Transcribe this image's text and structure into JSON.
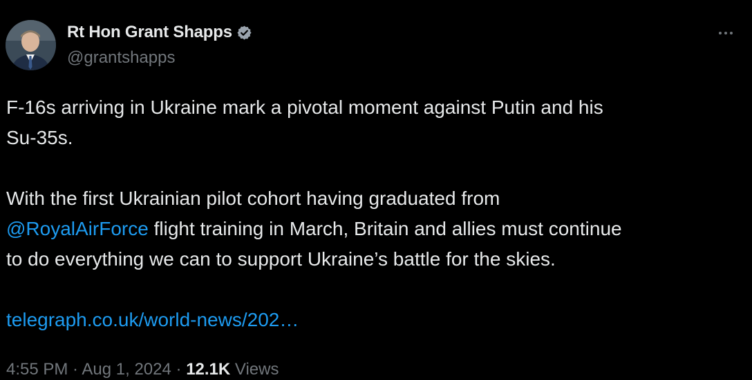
{
  "author": {
    "display_name": "Rt Hon Grant Shapps",
    "handle": "@grantshapps",
    "verified": true,
    "verified_badge_color": "#9aa3ad"
  },
  "tweet": {
    "line1": "F-16s arriving in Ukraine mark a pivotal moment against Putin and his",
    "line2": "Su-35s.",
    "line3": "With the first Ukrainian pilot cohort having graduated from",
    "mention": "@RoyalAirForce",
    "line4_rest": " flight training in March, Britain and allies must continue",
    "line5": "to do everything we can to support Ukraine’s battle for the skies.",
    "link_text": "telegraph.co.uk/world-news/202…"
  },
  "meta": {
    "time": "4:55 PM",
    "sep1": " · ",
    "date": "Aug 1, 2024",
    "sep2": " · ",
    "views_count": "12.1K",
    "views_label": " Views"
  },
  "icons": {
    "verified": "verified-badge-icon",
    "more": "more-options-icon"
  },
  "colors": {
    "background": "#000000",
    "text": "#e7e9ea",
    "secondary": "#71767b",
    "link": "#1d9bf0"
  }
}
